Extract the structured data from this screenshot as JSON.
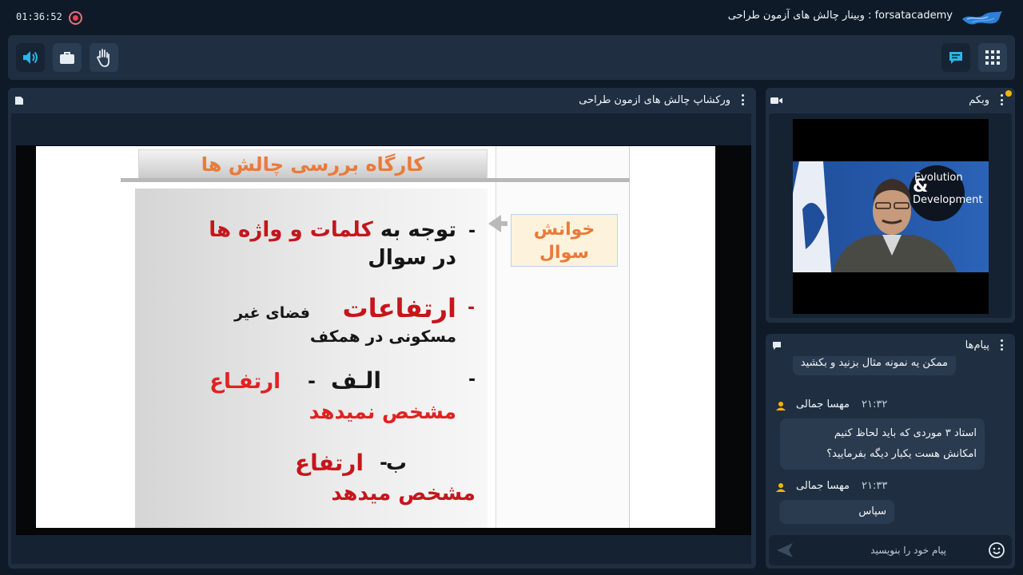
{
  "header": {
    "timer": "01:36:52",
    "title": "forsatacademy : وبینار چالش های آزمون طراحی"
  },
  "toolbar": {
    "left_buttons": [
      "speaker-icon",
      "briefcase-icon",
      "hand-icon"
    ],
    "right_buttons": [
      "chat-icon",
      "apps-grid-icon"
    ]
  },
  "presentation": {
    "title": "ورکشاپ چالش های ازمون طراحی",
    "slide": {
      "title": "کارگاه بررسی چالش ها",
      "side_label_1": "خوانش",
      "side_label_2": "سوال",
      "b1_prefix": "توجه به",
      "b1_highlight": "کلمات و واژه ها",
      "b1_line2": "در سوال",
      "b2_highlight": "ارتفاعات",
      "b2_text1": "فضای غیر",
      "b2_text2": "مسکونی در همکف",
      "b3_label": "الـف",
      "b3_sep": "-",
      "b3_highlight": "ارتفـاع",
      "b3_line2": "مشخص نمیدهد",
      "b4_label": "ب",
      "b4_sep": "-",
      "b4_highlight": "ارتفاع",
      "b4_line2": "مشخص میدهد"
    }
  },
  "webcam": {
    "title": "وبکم",
    "backdrop_text_1": "Evolution",
    "backdrop_text_2": "Development"
  },
  "chat": {
    "title": "پیام‌ها",
    "messages": [
      {
        "text": "ممکن یه نمونه مثال بزنید و بکشید"
      },
      {
        "name": "مهسا جمالی",
        "time": "۲۱:۳۲",
        "line1": "استاد ۳ موردی که باید لحاظ کنیم",
        "line2": "امکانش هست یکبار دیگه بفرمایید؟"
      },
      {
        "name": "مهسا جمالی",
        "time": "۲۱:۳۳",
        "text": "سپاس"
      }
    ],
    "input_placeholder": "پیام خود را بنویسید"
  },
  "colors": {
    "accent": "#2bb6e8",
    "slide_title": "#ea7a3b",
    "slide_red": "#c4161c",
    "user_icon": "#f4b400",
    "record": "#e54356"
  }
}
